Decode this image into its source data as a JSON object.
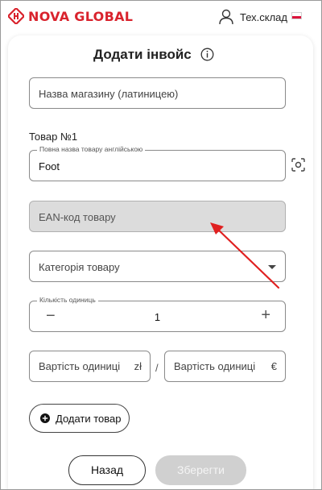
{
  "header": {
    "logo_text": "NOVA GLOBAL",
    "user_label": "Тех.склад",
    "brand_color": "#d9232d"
  },
  "form": {
    "title": "Додати інвойс",
    "shop_name_placeholder": "Назва магазину (латиницею)",
    "product_section_label": "Товар №1",
    "product_name_legend": "Повна назва товару англійською",
    "product_name_value": "Foot",
    "ean_placeholder": "EAN-код товару",
    "category_placeholder": "Категорія товару",
    "quantity_legend": "Кількість одиниць",
    "quantity_value": "1",
    "quantity_minus": "−",
    "quantity_plus": "+",
    "unit_price_pln_placeholder": "Вартість одиниці",
    "unit_price_pln_currency": "zł",
    "separator": "/",
    "unit_price_eur_placeholder": "Вартість одиниці",
    "unit_price_eur_currency": "€",
    "add_product_label": "Додати товар",
    "back_label": "Назад",
    "save_label": "Зберегти"
  },
  "annotation": {
    "arrow_color": "#e02020"
  }
}
